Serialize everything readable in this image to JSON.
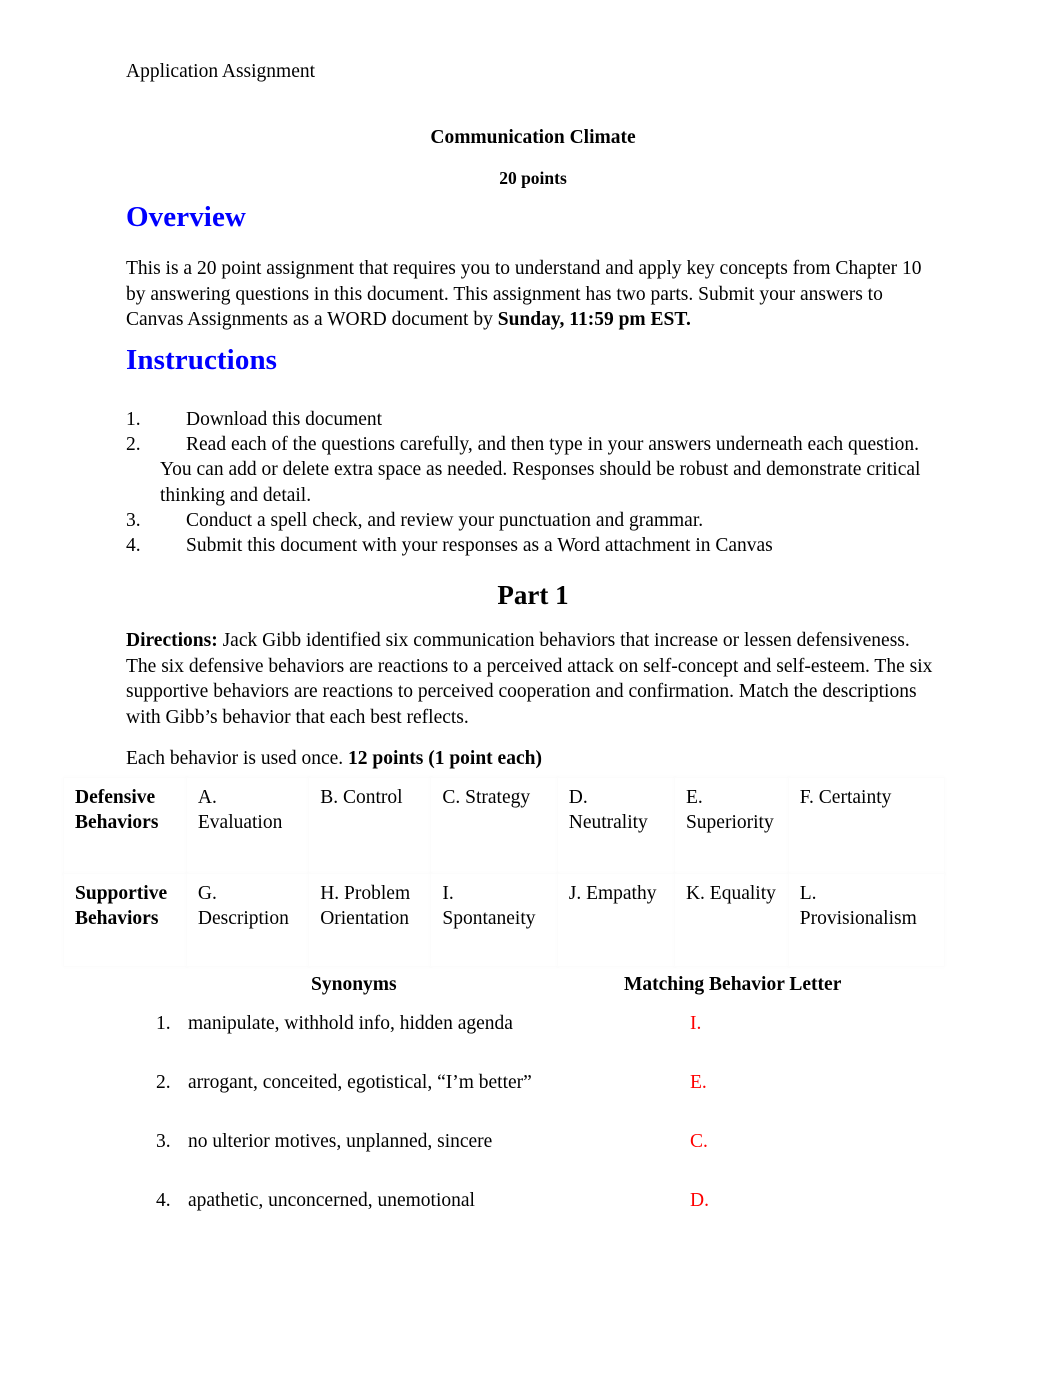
{
  "document": {
    "running_head": "Application Assignment",
    "title": "Communication Climate",
    "subtitle": "20 points"
  },
  "overview": {
    "heading": "Overview",
    "paragraph_plain": "This is a 20 point assignment that requires you to understand and apply key concepts from Chapter 10 by answering questions in this document. This assignment has two parts. Submit your answers to Canvas Assignments as a WORD document by ",
    "paragraph_bold_tail": "Sunday, 11:59 pm EST."
  },
  "instructions": {
    "heading": "Instructions",
    "items": [
      {
        "number": "1.",
        "text": "Download this document"
      },
      {
        "number": "2.",
        "text": "Read each of the questions carefully, and then type in your answers underneath each question. You can add or delete extra space as needed. Responses should be robust and demonstrate critical thinking and detail."
      },
      {
        "number": "3.",
        "text": "Conduct a spell check, and review your punctuation and grammar."
      },
      {
        "number": "4.",
        "text": "Submit this document with your responses as a Word attachment in Canvas"
      }
    ]
  },
  "part1": {
    "heading": "Part 1",
    "directions_label": "Directions:",
    "directions_text": " Jack Gibb identified six communication behaviors that increase or lessen defensiveness. The six defensive behaviors are reactions to a perceived attack on self-concept and self-esteem. The six supportive behaviors are reactions to perceived cooperation and confirmation. Match the descriptions with Gibb’s behavior that each best reflects.",
    "usage_note_plain": "Each behavior is used once. ",
    "usage_note_bold": "12 points (1 point each)"
  },
  "behaviors_table": {
    "rows": [
      {
        "label": "Defensive Behaviors",
        "cells": [
          {
            "letter": "A.",
            "name": "Evaluation"
          },
          {
            "letter": "B.",
            "name": "Control"
          },
          {
            "letter": "C.",
            "name": "Strategy"
          },
          {
            "letter": "D.",
            "name": "Neutrality"
          },
          {
            "letter": "E.",
            "name": "Superiority"
          },
          {
            "letter": "F.",
            "name": "Certainty"
          }
        ]
      },
      {
        "label": "Supportive Behaviors",
        "cells": [
          {
            "letter": "G.",
            "name": "Description"
          },
          {
            "letter": "H.",
            "name": "Problem Orientation"
          },
          {
            "letter": "I.",
            "name": "Spontaneity"
          },
          {
            "letter": "J.",
            "name": "Empathy"
          },
          {
            "letter": "K.",
            "name": "Equality"
          },
          {
            "letter": "L.",
            "name": "Provisionalism"
          }
        ]
      }
    ]
  },
  "matching": {
    "synonyms_header": "Synonyms",
    "answer_header": "Matching Behavior Letter",
    "answer_color": "#FF0000",
    "rows": [
      {
        "number": "1.",
        "synonyms": "manipulate, withhold info, hidden agenda",
        "answer": "I."
      },
      {
        "number": "2.",
        "synonyms": "arrogant, conceited, egotistical, “I’m better”",
        "answer": "E."
      },
      {
        "number": "3.",
        "synonyms": "no ulterior motives, unplanned, sincere",
        "answer": "C."
      },
      {
        "number": "4.",
        "synonyms": "apathetic, unconcerned, unemotional",
        "answer": "D."
      }
    ]
  },
  "colors": {
    "heading_blue": "#0000FF",
    "answer_red": "#FF0000",
    "text_black": "#000000"
  }
}
